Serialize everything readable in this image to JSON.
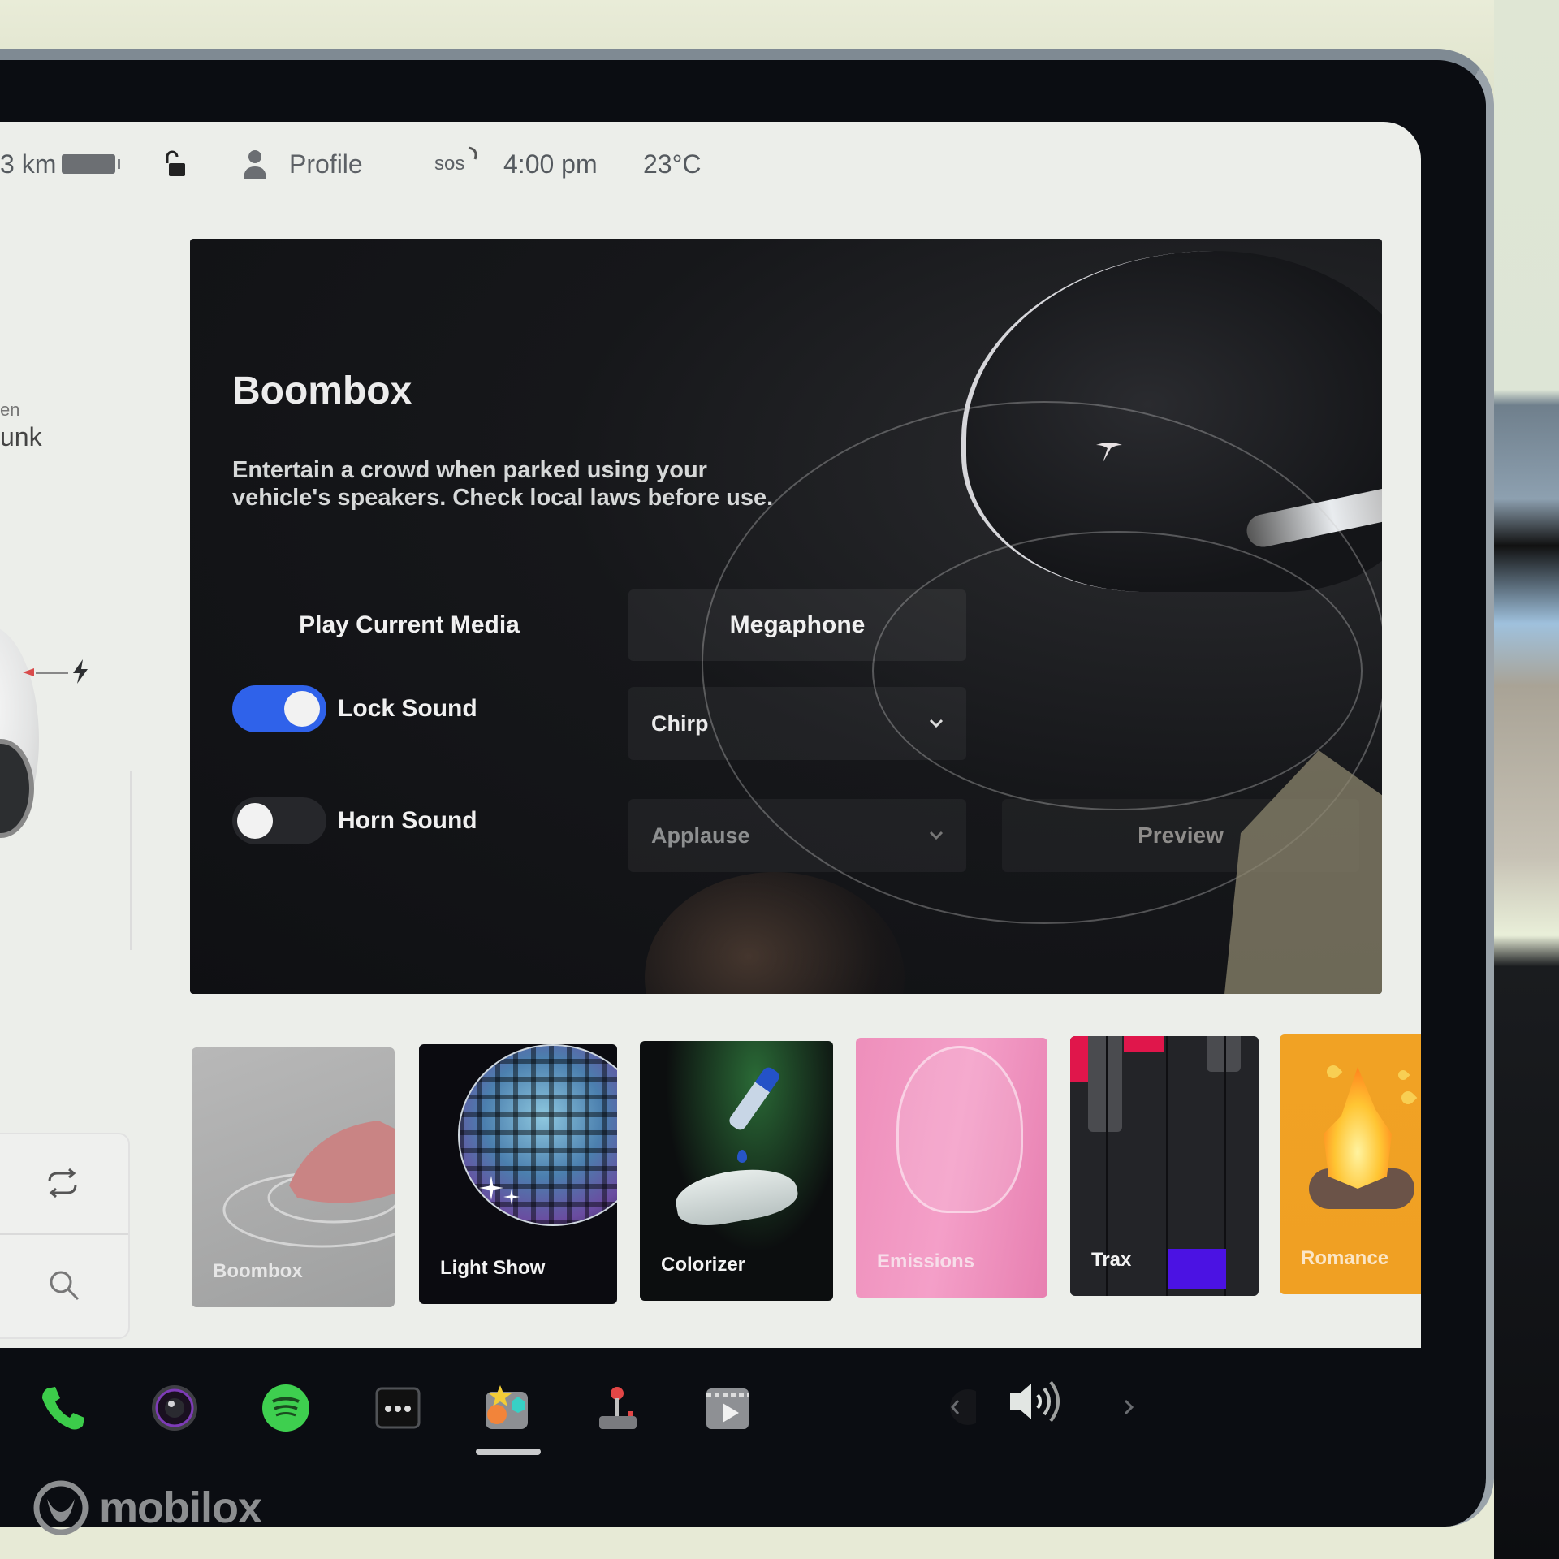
{
  "status_bar": {
    "range": "3 km",
    "profile_label": "Profile",
    "sos_label": "sos",
    "time": "4:00 pm",
    "temperature": "23°C"
  },
  "sidebar": {
    "partial_small": "en",
    "partial_big": "unk",
    "icons": [
      "sync-icon",
      "search-icon"
    ]
  },
  "boombox": {
    "title": "Boombox",
    "description": "Entertain a crowd when parked using your vehicle's speakers. Check local laws before use.",
    "modes": [
      {
        "label": "Play Current Media",
        "selected": false
      },
      {
        "label": "Megaphone",
        "selected": true
      }
    ],
    "lock_sound": {
      "label": "Lock Sound",
      "enabled": true,
      "value": "Chirp"
    },
    "horn_sound": {
      "label": "Horn Sound",
      "enabled": false,
      "value": "Applause"
    },
    "preview_label": "Preview",
    "accent_color": "#2f62ea"
  },
  "apps": [
    {
      "label": "Boombox",
      "active": true
    },
    {
      "label": "Light Show"
    },
    {
      "label": "Colorizer"
    },
    {
      "label": "Emissions"
    },
    {
      "label": "Trax"
    },
    {
      "label": "Romance"
    }
  ],
  "dock": {
    "icons": [
      "phone-icon",
      "camera-icon",
      "spotify-icon",
      "more-icon",
      "toybox-icon",
      "arcade-icon",
      "theater-icon"
    ],
    "active": "toybox-icon",
    "volume": [
      "chevron-left-icon",
      "volume-icon",
      "chevron-right-icon"
    ]
  },
  "watermark": "mobilox"
}
